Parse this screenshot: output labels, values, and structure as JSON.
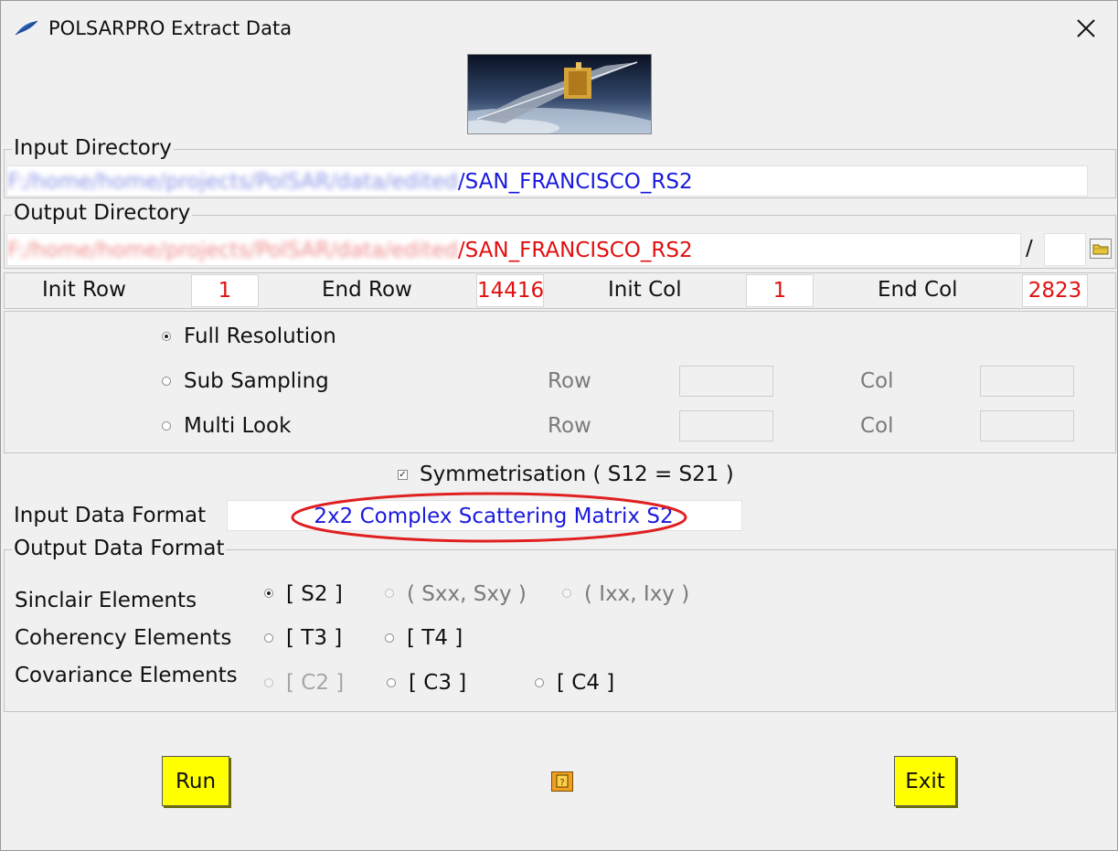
{
  "window": {
    "title": "POLSARPRO Extract Data"
  },
  "input_directory": {
    "legend": "Input Directory",
    "path_prefix": "F:/home/home/projects/PolSAR/data/edited",
    "path_suffix": "/SAN_FRANCISCO_RS2",
    "color": "#1a1adc"
  },
  "output_directory": {
    "legend": "Output Directory",
    "path_prefix": "F:/home/home/projects/PolSAR/data/edited",
    "path_suffix": "/SAN_FRANCISCO_RS2",
    "slash": "/",
    "subdir": "",
    "color": "#e01010"
  },
  "extent": {
    "init_row_label": "Init Row",
    "init_row": "1",
    "end_row_label": "End Row",
    "end_row": "14416",
    "init_col_label": "Init Col",
    "init_col": "1",
    "end_col_label": "End Col",
    "end_col": "2823"
  },
  "resolution": {
    "full_label": "Full Resolution",
    "sub_label": "Sub Sampling",
    "multi_label": "Multi Look",
    "row_label": "Row",
    "col_label": "Col",
    "selected": "full"
  },
  "symmetrisation": {
    "label": "Symmetrisation ( S12 = S21 )",
    "checked": true
  },
  "input_format": {
    "label": "Input Data Format",
    "value": "2x2 Complex Scattering Matrix S2"
  },
  "output_format": {
    "legend": "Output Data Format",
    "sinclair_label": "Sinclair Elements",
    "coherency_label": "Coherency Elements",
    "covariance_label": "Covariance Elements",
    "s2": "[ S2 ]",
    "sxx": "( Sxx, Sxy )",
    "ixx": "( Ixx, Ixy )",
    "t3": "[ T3 ]",
    "t4": "[ T4 ]",
    "c2": "[ C2 ]",
    "c3": "[ C3 ]",
    "c4": "[ C4 ]",
    "selected": "S2"
  },
  "buttons": {
    "run": "Run",
    "exit": "Exit",
    "help_icon": "help-icon"
  },
  "colors": {
    "button": "#ffff00",
    "highlight_ellipse": "#e02020"
  }
}
